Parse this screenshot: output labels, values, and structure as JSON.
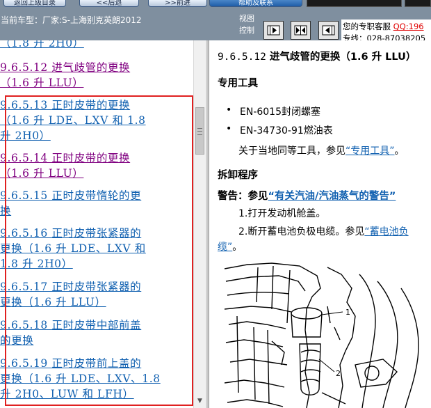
{
  "toolbar": {
    "buttons": [
      "返回上级目录",
      "<<后退",
      ">>前进",
      "帮助及联系"
    ],
    "car_label": "当前车型：厂家:S-上海别克英朗2012",
    "view_label": "视图控制"
  },
  "customer_service": {
    "label": "您的专职客服",
    "qq": "QQ:196",
    "phone": "专线：028-87038205"
  },
  "toc": [
    {
      "lines": [
        "（1.8 升 2H0）"
      ],
      "visited": false
    },
    {
      "lines": [
        " 9.6.5.12 进气歧管的更换",
        "（1.6 升 LLU）"
      ],
      "visited": true
    },
    {
      "lines": [
        " 9.6.5.13 正时皮带的更换",
        "（1.6 升 LDE、LXV 和 1.8",
        "升 2H0）"
      ],
      "visited": false
    },
    {
      "lines": [
        " 9.6.5.14 正时皮带的更换",
        "（1.6 升 LLU）"
      ],
      "visited": true
    },
    {
      "lines": [
        " 9.6.5.15 正时皮带惰轮的更",
        "换"
      ],
      "visited": false
    },
    {
      "lines": [
        " 9.6.5.16 正时皮带张紧器的",
        "更换（1.6 升 LDE、LXV 和",
        "1.8 升 2H0）"
      ],
      "visited": false
    },
    {
      "lines": [
        " 9.6.5.17 正时皮带张紧器的",
        "更换（1.6 升 LLU）"
      ],
      "visited": false
    },
    {
      "lines": [
        " 9.6.5.18 正时皮带中部前盖",
        "的更换"
      ],
      "visited": false
    },
    {
      "lines": [
        " 9.6.5.19 正时皮带前上盖的",
        "更换（1.6 升 LDE、LXV、1.8",
        "升 2H0、LUW 和 LFH）"
      ],
      "visited": false
    }
  ],
  "content": {
    "title_num": "9.6.5.12",
    "title_text": " 进气歧管的更换（1.6 升  LLU）",
    "special_tools_heading": "专用工具",
    "tools": [
      "EN-6015封闭螺塞",
      "EN-34730-91燃油表"
    ],
    "equivalent_prefix": "关于当地同等工具，参见",
    "equivalent_link": "“专用工具”",
    "equivalent_suffix": "。",
    "removal_heading": "拆卸程序",
    "warning_label": "警告：参见",
    "warning_link": "“有关汽油/汽油蒸气的警告”",
    "step1": "1.打开发动机舱盖。",
    "step2_prefix": "2.断开蓄电池负极电缆。参见",
    "step2_link": "“蓄电池负",
    "step2_cont_link": "缆”",
    "step2_cont_suffix": "。",
    "figure_callouts": [
      "1",
      "2"
    ]
  },
  "colors": {
    "toolbar_bg": "#7f8f9f",
    "link": "#1060b0",
    "visited_link": "#800080",
    "highlight_box": "#e02020",
    "qq_text": "#e00000"
  }
}
